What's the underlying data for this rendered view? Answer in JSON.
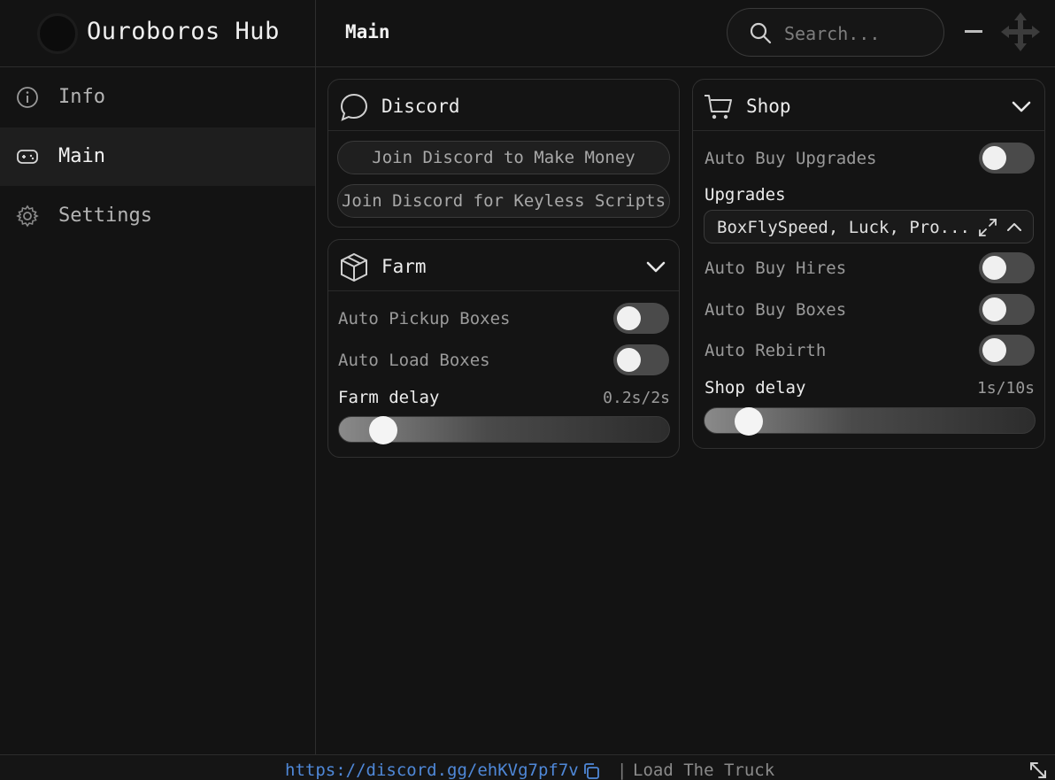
{
  "app": {
    "title": "Ouroboros Hub"
  },
  "header": {
    "page_title": "Main",
    "search_placeholder": "Search..."
  },
  "sidebar": {
    "items": [
      {
        "label": "Info",
        "icon": "info-icon",
        "active": false
      },
      {
        "label": "Main",
        "icon": "gamepad-icon",
        "active": true
      },
      {
        "label": "Settings",
        "icon": "gear-icon",
        "active": false
      }
    ]
  },
  "discord": {
    "title": "Discord",
    "buttons": [
      {
        "label": "Join Discord to Make Money"
      },
      {
        "label": "Join Discord for Keyless Scripts"
      }
    ]
  },
  "farm": {
    "title": "Farm",
    "toggles": [
      {
        "label": "Auto Pickup Boxes",
        "on": false
      },
      {
        "label": "Auto Load Boxes",
        "on": false
      }
    ],
    "delay": {
      "label": "Farm delay",
      "value_text": "0.2s/2s",
      "fraction": 0.1
    }
  },
  "shop": {
    "title": "Shop",
    "auto_buy_upgrades": {
      "label": "Auto Buy Upgrades",
      "on": false
    },
    "upgrades": {
      "label": "Upgrades",
      "value": "BoxFlySpeed, Luck, Pro..."
    },
    "toggles": [
      {
        "label": "Auto Buy Hires",
        "on": false
      },
      {
        "label": "Auto Buy Boxes",
        "on": false
      },
      {
        "label": "Auto Rebirth",
        "on": false
      }
    ],
    "delay": {
      "label": "Shop delay",
      "value_text": "1s/10s",
      "fraction": 0.1
    }
  },
  "footer": {
    "link": "https://discord.gg/ehKVg7pf7v",
    "separator": "|",
    "game": "Load The Truck"
  },
  "colors": {
    "background": "#131313",
    "card": "#141414",
    "border": "#303030",
    "link": "#4f88d8",
    "toggle_track": "#4a4a4a",
    "knob": "#f0f0f0"
  }
}
